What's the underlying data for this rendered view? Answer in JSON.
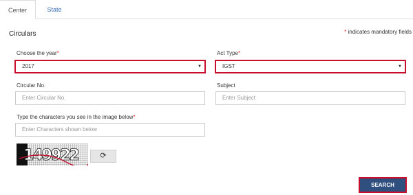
{
  "tabs": [
    {
      "label": "Center",
      "active": true
    },
    {
      "label": "State",
      "active": false
    }
  ],
  "section": {
    "title": "Circulars",
    "mandatory_note": "indicates mandatory fields"
  },
  "form": {
    "year": {
      "label": "Choose the year",
      "value": "2017",
      "required": true
    },
    "act_type": {
      "label": "Act Type",
      "value": "IGST",
      "required": true
    },
    "circular_no": {
      "label": "Circular No.",
      "placeholder": "Enter Circular No."
    },
    "subject": {
      "label": "Subject",
      "placeholder": "Enter Subject"
    },
    "captcha": {
      "label": "Type the characters you see in the image below",
      "placeholder": "Enter Characters shown below",
      "required": true,
      "image_text": "149922"
    },
    "refresh_icon": "refresh-icon",
    "search_label": "SEARCH"
  },
  "colors": {
    "required_star": "#e4252b",
    "highlight_border": "#c8102e",
    "button_bg": "#2f4f7f",
    "tab_link": "#3d6fb0"
  }
}
